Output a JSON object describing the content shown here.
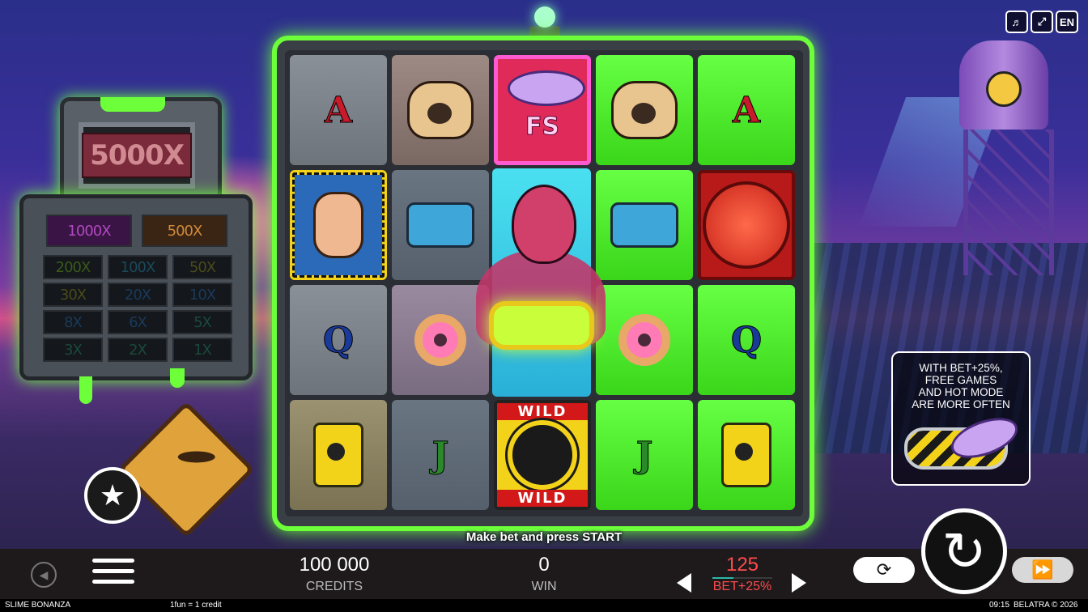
{
  "game": {
    "title": "SLIME BONANZA"
  },
  "top_controls": {
    "sound_icon": "speaker-icon",
    "fullscreen_icon": "fullscreen-icon",
    "language": "EN"
  },
  "paytable": {
    "jackpot": "5000X",
    "row2": [
      "1000X",
      "500X"
    ],
    "grid": [
      [
        "200X",
        "100X",
        "50X"
      ],
      [
        "30X",
        "20X",
        "10X"
      ],
      [
        "8X",
        "6X",
        "5X"
      ],
      [
        "3X",
        "2X",
        "1X"
      ]
    ]
  },
  "reels": {
    "row1": [
      "A",
      "pug",
      "FS",
      "pug",
      "A"
    ],
    "row2": [
      "man",
      "gun",
      "alien",
      "gun",
      "shutter"
    ],
    "row3": [
      "Q",
      "donut",
      "alien",
      "donut",
      "Q"
    ],
    "row4": [
      "barrel",
      "J",
      "WILD",
      "J",
      "barrel"
    ],
    "wild_label": "WILD",
    "fs_label": "FS"
  },
  "message": "Make bet and press START",
  "promo": {
    "text": "WITH BET+25%,\nFREE GAMES\nAND HOT MODE\nARE MORE OFTEN",
    "line1": "WITH BET+25%,",
    "line2": "FREE GAMES",
    "line3": "AND HOT MODE",
    "line4": "ARE MORE OFTEN"
  },
  "bottom": {
    "credits_value": "100 000",
    "credits_label": "CREDITS",
    "win_value": "0",
    "win_label": "WIN",
    "bet_value": "125",
    "bet_label": "BET+25%",
    "icons": {
      "back": "back-icon",
      "menu": "menu-icon",
      "autoplay": "autoplay-icon",
      "spin": "spin-icon",
      "turbo": "turbo-icon",
      "prev": "arrow-left-icon",
      "next": "arrow-right-icon",
      "star": "star-icon"
    }
  },
  "status_bar": {
    "game_name": "SLIME BONANZA",
    "rate": "1fun = 1 credit",
    "time": "09:15",
    "copyright": "BELATRA © 2026"
  },
  "colors": {
    "slime": "#6cff3a",
    "bet_red": "#ff4a4a",
    "bar": "#1e1a1c"
  }
}
